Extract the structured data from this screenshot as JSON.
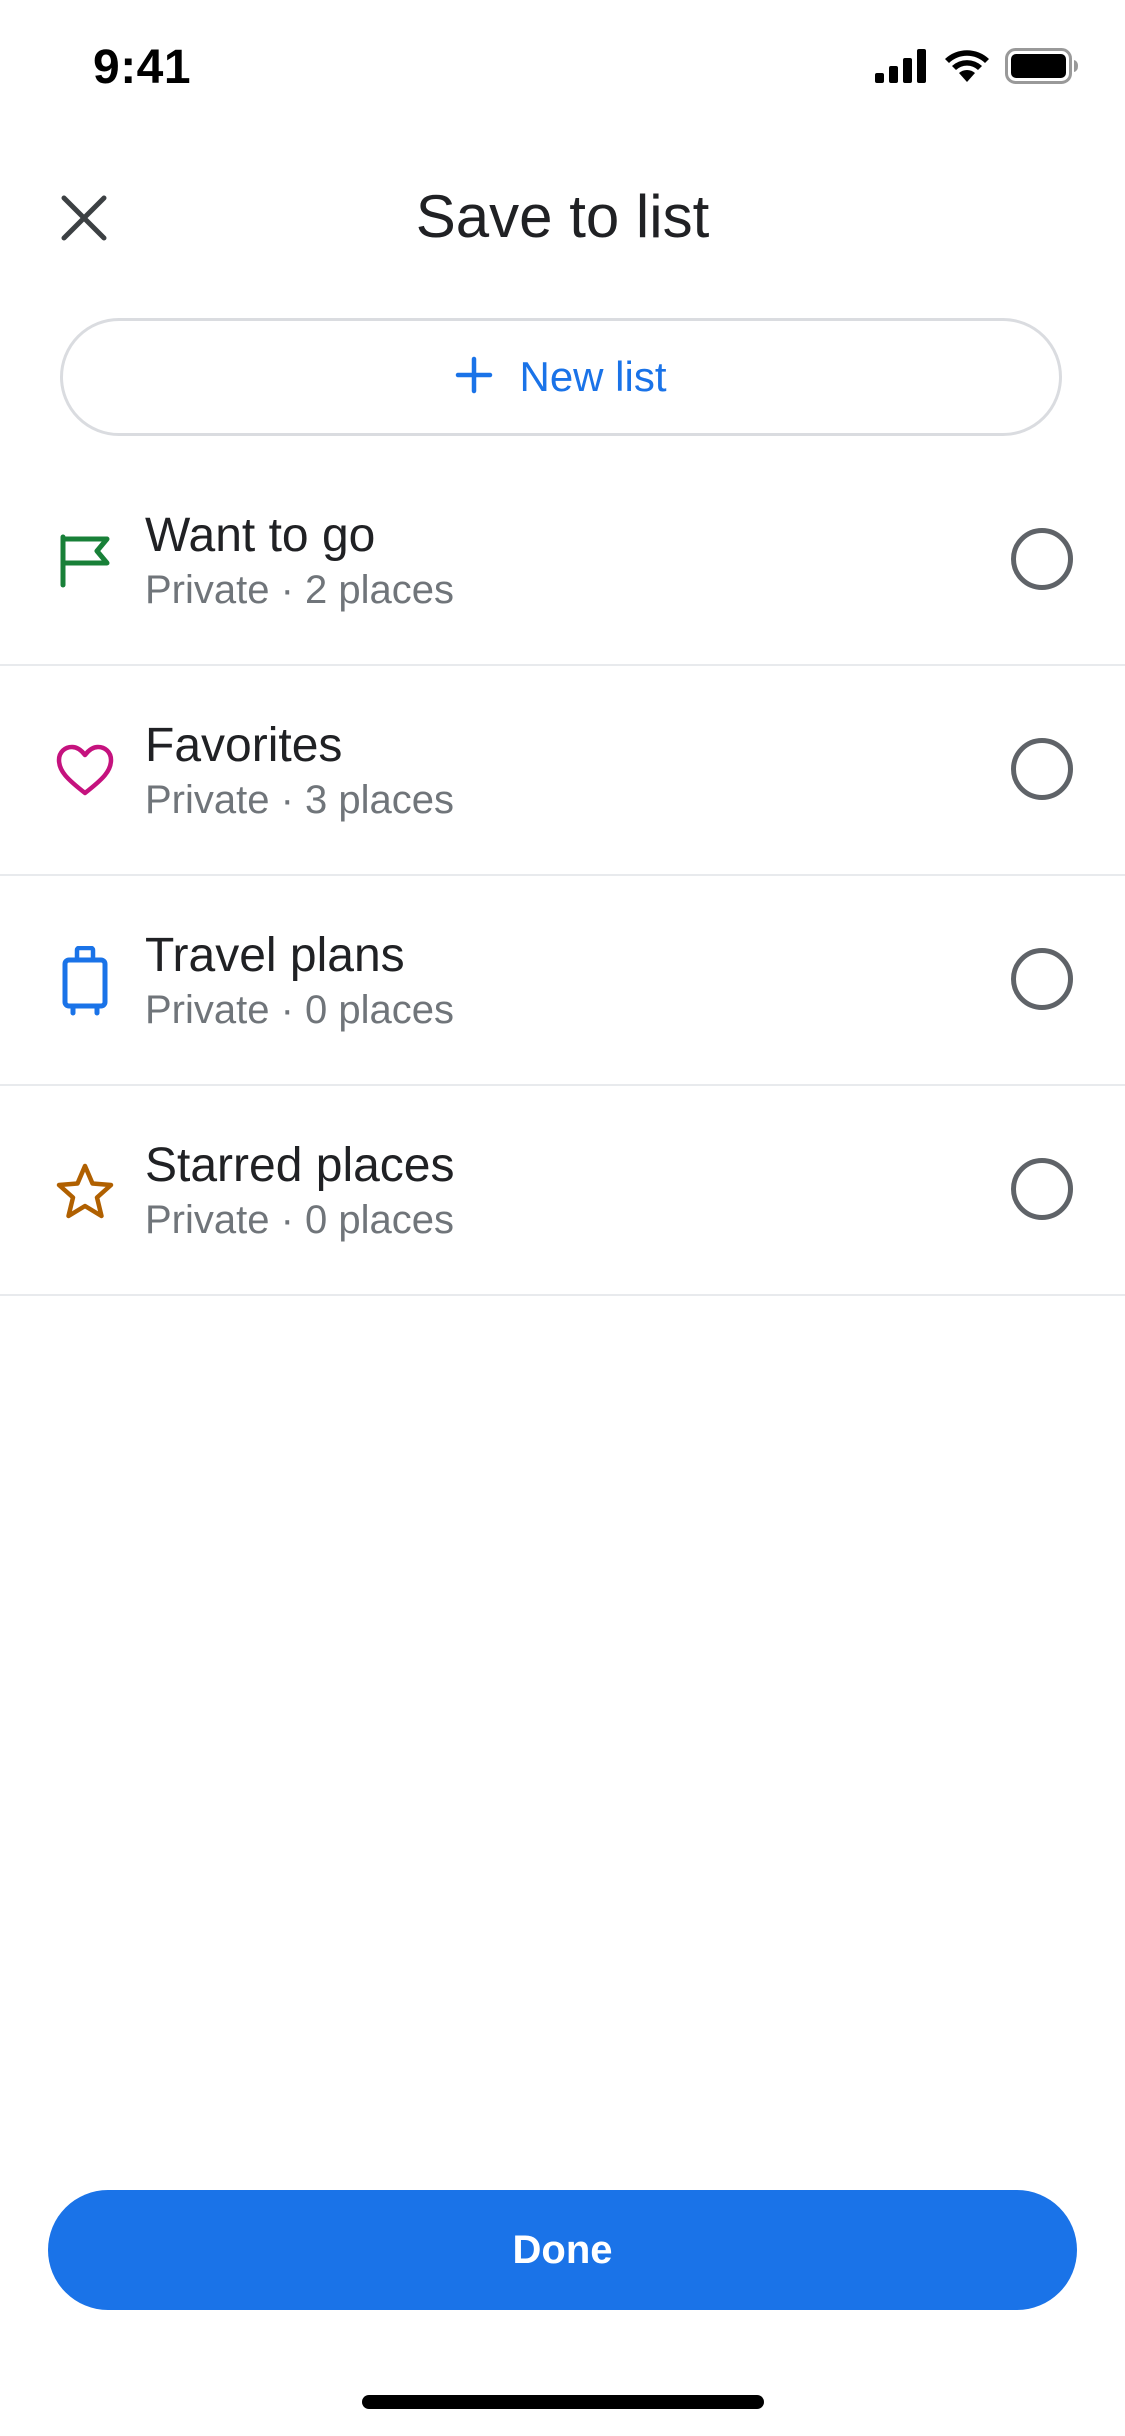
{
  "status_bar": {
    "time": "9:41",
    "icons": [
      "cellular-signal-icon",
      "wifi-icon",
      "battery-icon"
    ]
  },
  "header": {
    "title": "Save to list",
    "close_icon": "close-icon"
  },
  "new_list": {
    "label": "New list",
    "icon": "plus-icon"
  },
  "lists": [
    {
      "title": "Want to go",
      "subtitle": "Private · 2 places",
      "icon": "flag-icon",
      "color": "#188038"
    },
    {
      "title": "Favorites",
      "subtitle": "Private · 3 places",
      "icon": "heart-icon",
      "color": "#c5127e"
    },
    {
      "title": "Travel plans",
      "subtitle": "Private · 0 places",
      "icon": "suitcase-icon",
      "color": "#1a73e8"
    },
    {
      "title": "Starred places",
      "subtitle": "Private · 0 places",
      "icon": "star-icon",
      "color": "#b06000"
    }
  ],
  "footer": {
    "done_label": "Done"
  },
  "colors": {
    "accent": "#1a73e8",
    "divider": "#e8eaed",
    "text_primary": "#202124",
    "text_secondary": "#70757a"
  }
}
